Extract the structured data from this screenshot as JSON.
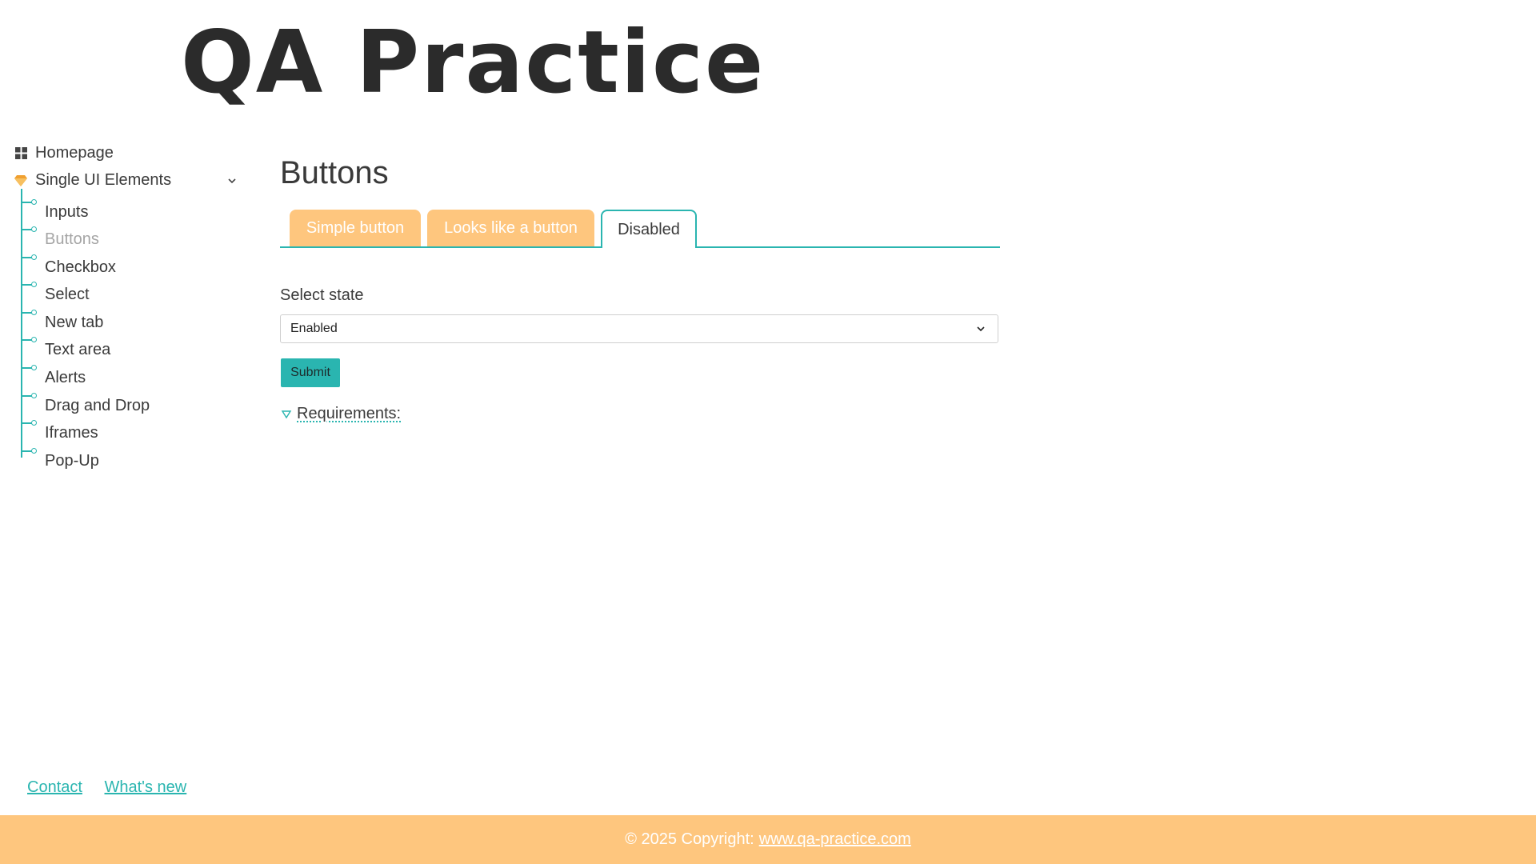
{
  "logo": "QA Practice",
  "sidebar": {
    "homepage": "Homepage",
    "section": "Single UI Elements",
    "items": [
      {
        "label": "Inputs"
      },
      {
        "label": "Buttons"
      },
      {
        "label": "Checkbox"
      },
      {
        "label": "Select"
      },
      {
        "label": "New tab"
      },
      {
        "label": "Text area"
      },
      {
        "label": "Alerts"
      },
      {
        "label": "Drag and Drop"
      },
      {
        "label": "Iframes"
      },
      {
        "label": "Pop-Up"
      }
    ]
  },
  "main": {
    "title": "Buttons",
    "tabs": [
      {
        "label": "Simple button"
      },
      {
        "label": "Looks like a button"
      },
      {
        "label": "Disabled"
      }
    ],
    "select_label": "Select state",
    "select_value": "Enabled",
    "submit_label": "Submit",
    "requirements": "Requirements:"
  },
  "footer_links": {
    "contact": "Contact",
    "whats_new": "What's new"
  },
  "footer": {
    "copyright": "© 2025 Copyright:",
    "site": "www.qa-practice.com"
  },
  "colors": {
    "accent": "#2ab5b0",
    "orange": "#fec67e",
    "text": "#3a3a3a"
  }
}
